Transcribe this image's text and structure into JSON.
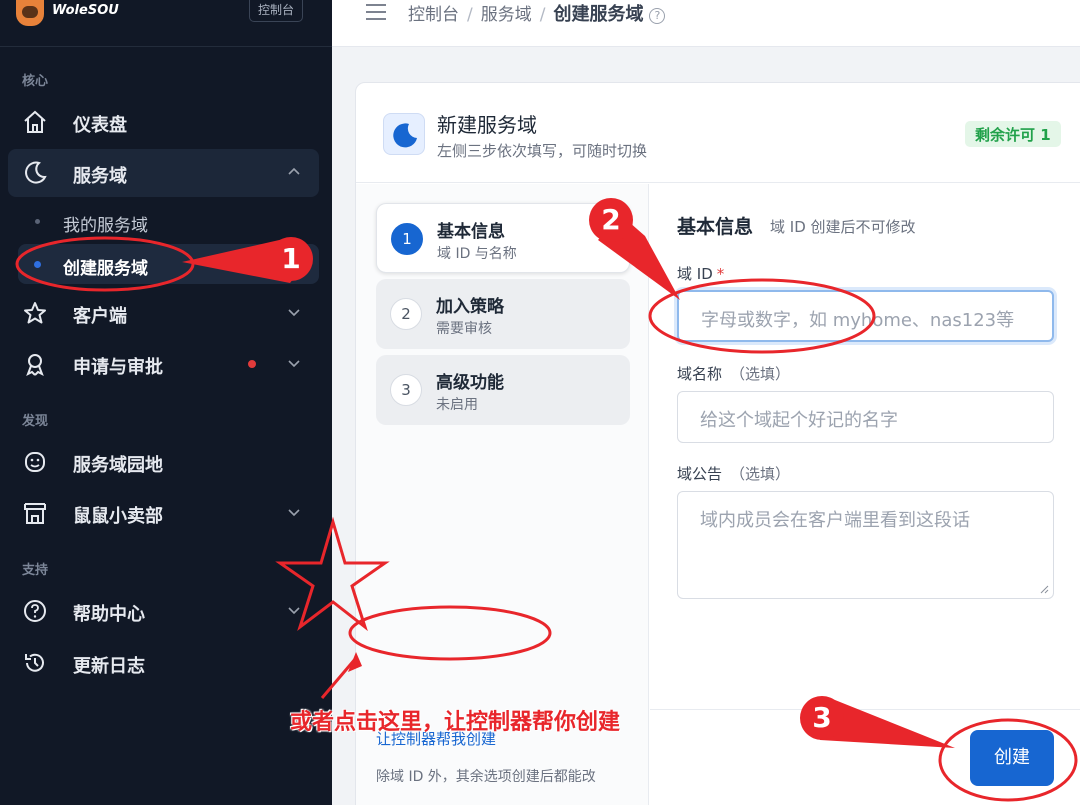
{
  "brand": {
    "name": "WoleSOU",
    "console_tag": "控制台"
  },
  "sidebar": {
    "sections": {
      "core": "核心",
      "discover": "发现",
      "support": "支持"
    },
    "items": {
      "dashboard": "仪表盘",
      "service_domain": "服务域",
      "my_domains": "我的服务域",
      "create_domain": "创建服务域",
      "clients": "客户端",
      "apply_review": "申请与审批",
      "domain_garden": "服务域园地",
      "shop": "鼠鼠小卖部",
      "help_center": "帮助中心",
      "changelog": "更新日志"
    }
  },
  "breadcrumb": {
    "root": "控制台",
    "parent": "服务域",
    "current": "创建服务域",
    "help_glyph": "?"
  },
  "card": {
    "title": "新建服务域",
    "subtitle": "左侧三步依次填写，可随时切换",
    "license_badge": "剩余许可 1"
  },
  "steps": [
    {
      "num": "1",
      "title": "基本信息",
      "sub": "域 ID 与名称",
      "active": true
    },
    {
      "num": "2",
      "title": "加入策略",
      "sub": "需要审核",
      "active": false
    },
    {
      "num": "3",
      "title": "高级功能",
      "sub": "未启用",
      "active": false
    }
  ],
  "assist": {
    "link": "让控制器帮我创建",
    "note": "除域 ID 外，其余选项创建后都能改"
  },
  "form": {
    "heading": "基本信息",
    "heading_note": "域 ID 创建后不可修改",
    "domain_id": {
      "label": "域 ID",
      "required": "*",
      "placeholder": "字母或数字，如 myhome、nas123等"
    },
    "domain_name": {
      "label": "域名称",
      "optional": "（选填）",
      "placeholder": "给这个域起个好记的名字"
    },
    "domain_notice": {
      "label": "域公告",
      "optional": "（选填）",
      "placeholder": "域内成员会在客户端里看到这段话"
    }
  },
  "create_button": "创建",
  "annotations": {
    "num1": "1",
    "num2": "2",
    "num3": "3",
    "caption": "或者点击这里，让控制器帮你创建"
  },
  "colors": {
    "accent": "#1766d1",
    "sidebar_bg": "#111826",
    "annotation": "#e8262b",
    "license_green": "#21a14a"
  }
}
